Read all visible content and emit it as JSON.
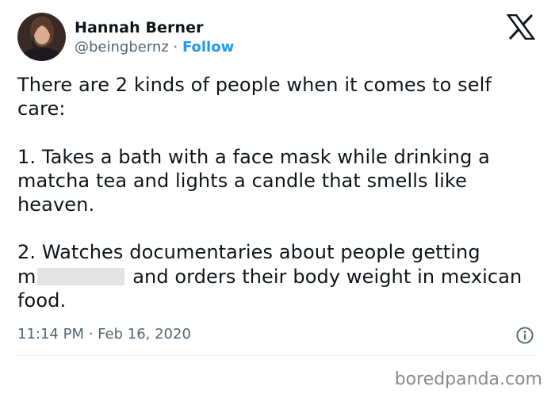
{
  "tweet": {
    "author": {
      "display_name": "Hannah Berner",
      "handle": "@beingbernz",
      "separator": " · ",
      "follow_label": "Follow"
    },
    "text_lines": {
      "line1": "There are 2 kinds of people when it comes to self",
      "line2": "care:",
      "line3": "1. Takes a bath with a face mask while drinking a",
      "line4": "matcha tea and lights a candle that smells like",
      "line5": "heaven.",
      "line6": "2. Watches documentaries about people getting",
      "line7_start": "m",
      "line7_end": " and orders their body weight in mexican",
      "line8": "food."
    },
    "timestamp": "11:14 PM · Feb 16, 2020",
    "icons": {
      "platform_logo": "x-logo-icon",
      "info": "info-icon"
    }
  },
  "watermark": "boredpanda.com",
  "colors": {
    "follow_link": "#1d9bf0",
    "secondary_text": "#536471",
    "primary_text": "#0f1419",
    "redaction": "#e3e3e3"
  }
}
